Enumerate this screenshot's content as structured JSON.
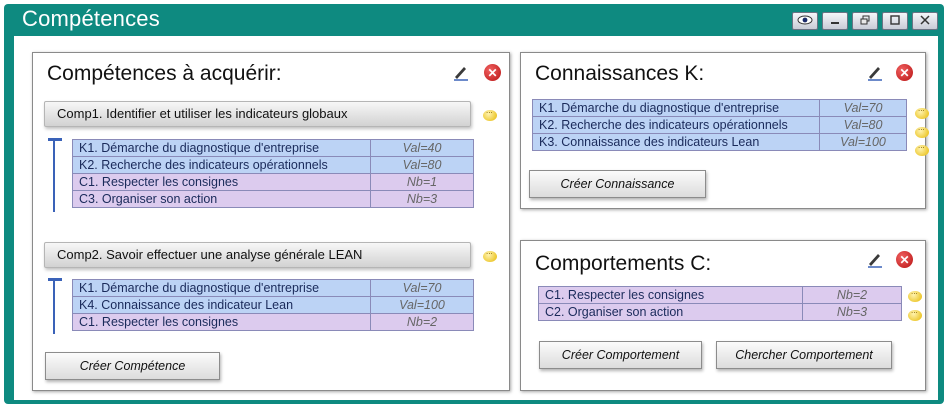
{
  "window": {
    "title": "Compétences"
  },
  "competences": {
    "title": "Compétences à acquérir:",
    "groups": [
      {
        "label": "Comp1. Identifier et utiliser les indicateurs globaux",
        "rows": [
          {
            "label": "K1. Démarche du diagnostique d'entreprise",
            "value": "Val=40",
            "kind": "k"
          },
          {
            "label": "K2. Recherche des indicateurs opérationnels",
            "value": "Val=80",
            "kind": "k"
          },
          {
            "label": "C1. Respecter les consignes",
            "value": "Nb=1",
            "kind": "c"
          },
          {
            "label": "C3. Organiser son action",
            "value": "Nb=3",
            "kind": "c"
          }
        ]
      },
      {
        "label": "Comp2. Savoir effectuer une analyse générale LEAN",
        "rows": [
          {
            "label": "K1. Démarche du diagnostique d'entreprise",
            "value": "Val=70",
            "kind": "k"
          },
          {
            "label": "K4. Connaissance des indicateur Lean",
            "value": "Val=100",
            "kind": "k"
          },
          {
            "label": "C1. Respecter les consignes",
            "value": "Nb=2",
            "kind": "c"
          }
        ]
      }
    ],
    "create_button": "Créer Compétence"
  },
  "connaissances": {
    "title": "Connaissances K:",
    "rows": [
      {
        "label": "K1. Démarche du diagnostique d'entreprise",
        "value": "Val=70"
      },
      {
        "label": "K2. Recherche des indicateurs opérationnels",
        "value": "Val=80"
      },
      {
        "label": "K3. Connaissance des indicateurs Lean",
        "value": "Val=100"
      }
    ],
    "create_button": "Créer Connaissance"
  },
  "comportements": {
    "title": "Comportements C:",
    "rows": [
      {
        "label": "C1. Respecter les consignes",
        "value": "Nb=2"
      },
      {
        "label": "C2. Organiser son action",
        "value": "Nb=3"
      }
    ],
    "create_button": "Créer Comportement",
    "search_button": "Chercher Comportement"
  },
  "colors": {
    "frame": "#0e8a80",
    "knowledge_row": "#bcd3f5",
    "behavior_row": "#dccbee"
  }
}
